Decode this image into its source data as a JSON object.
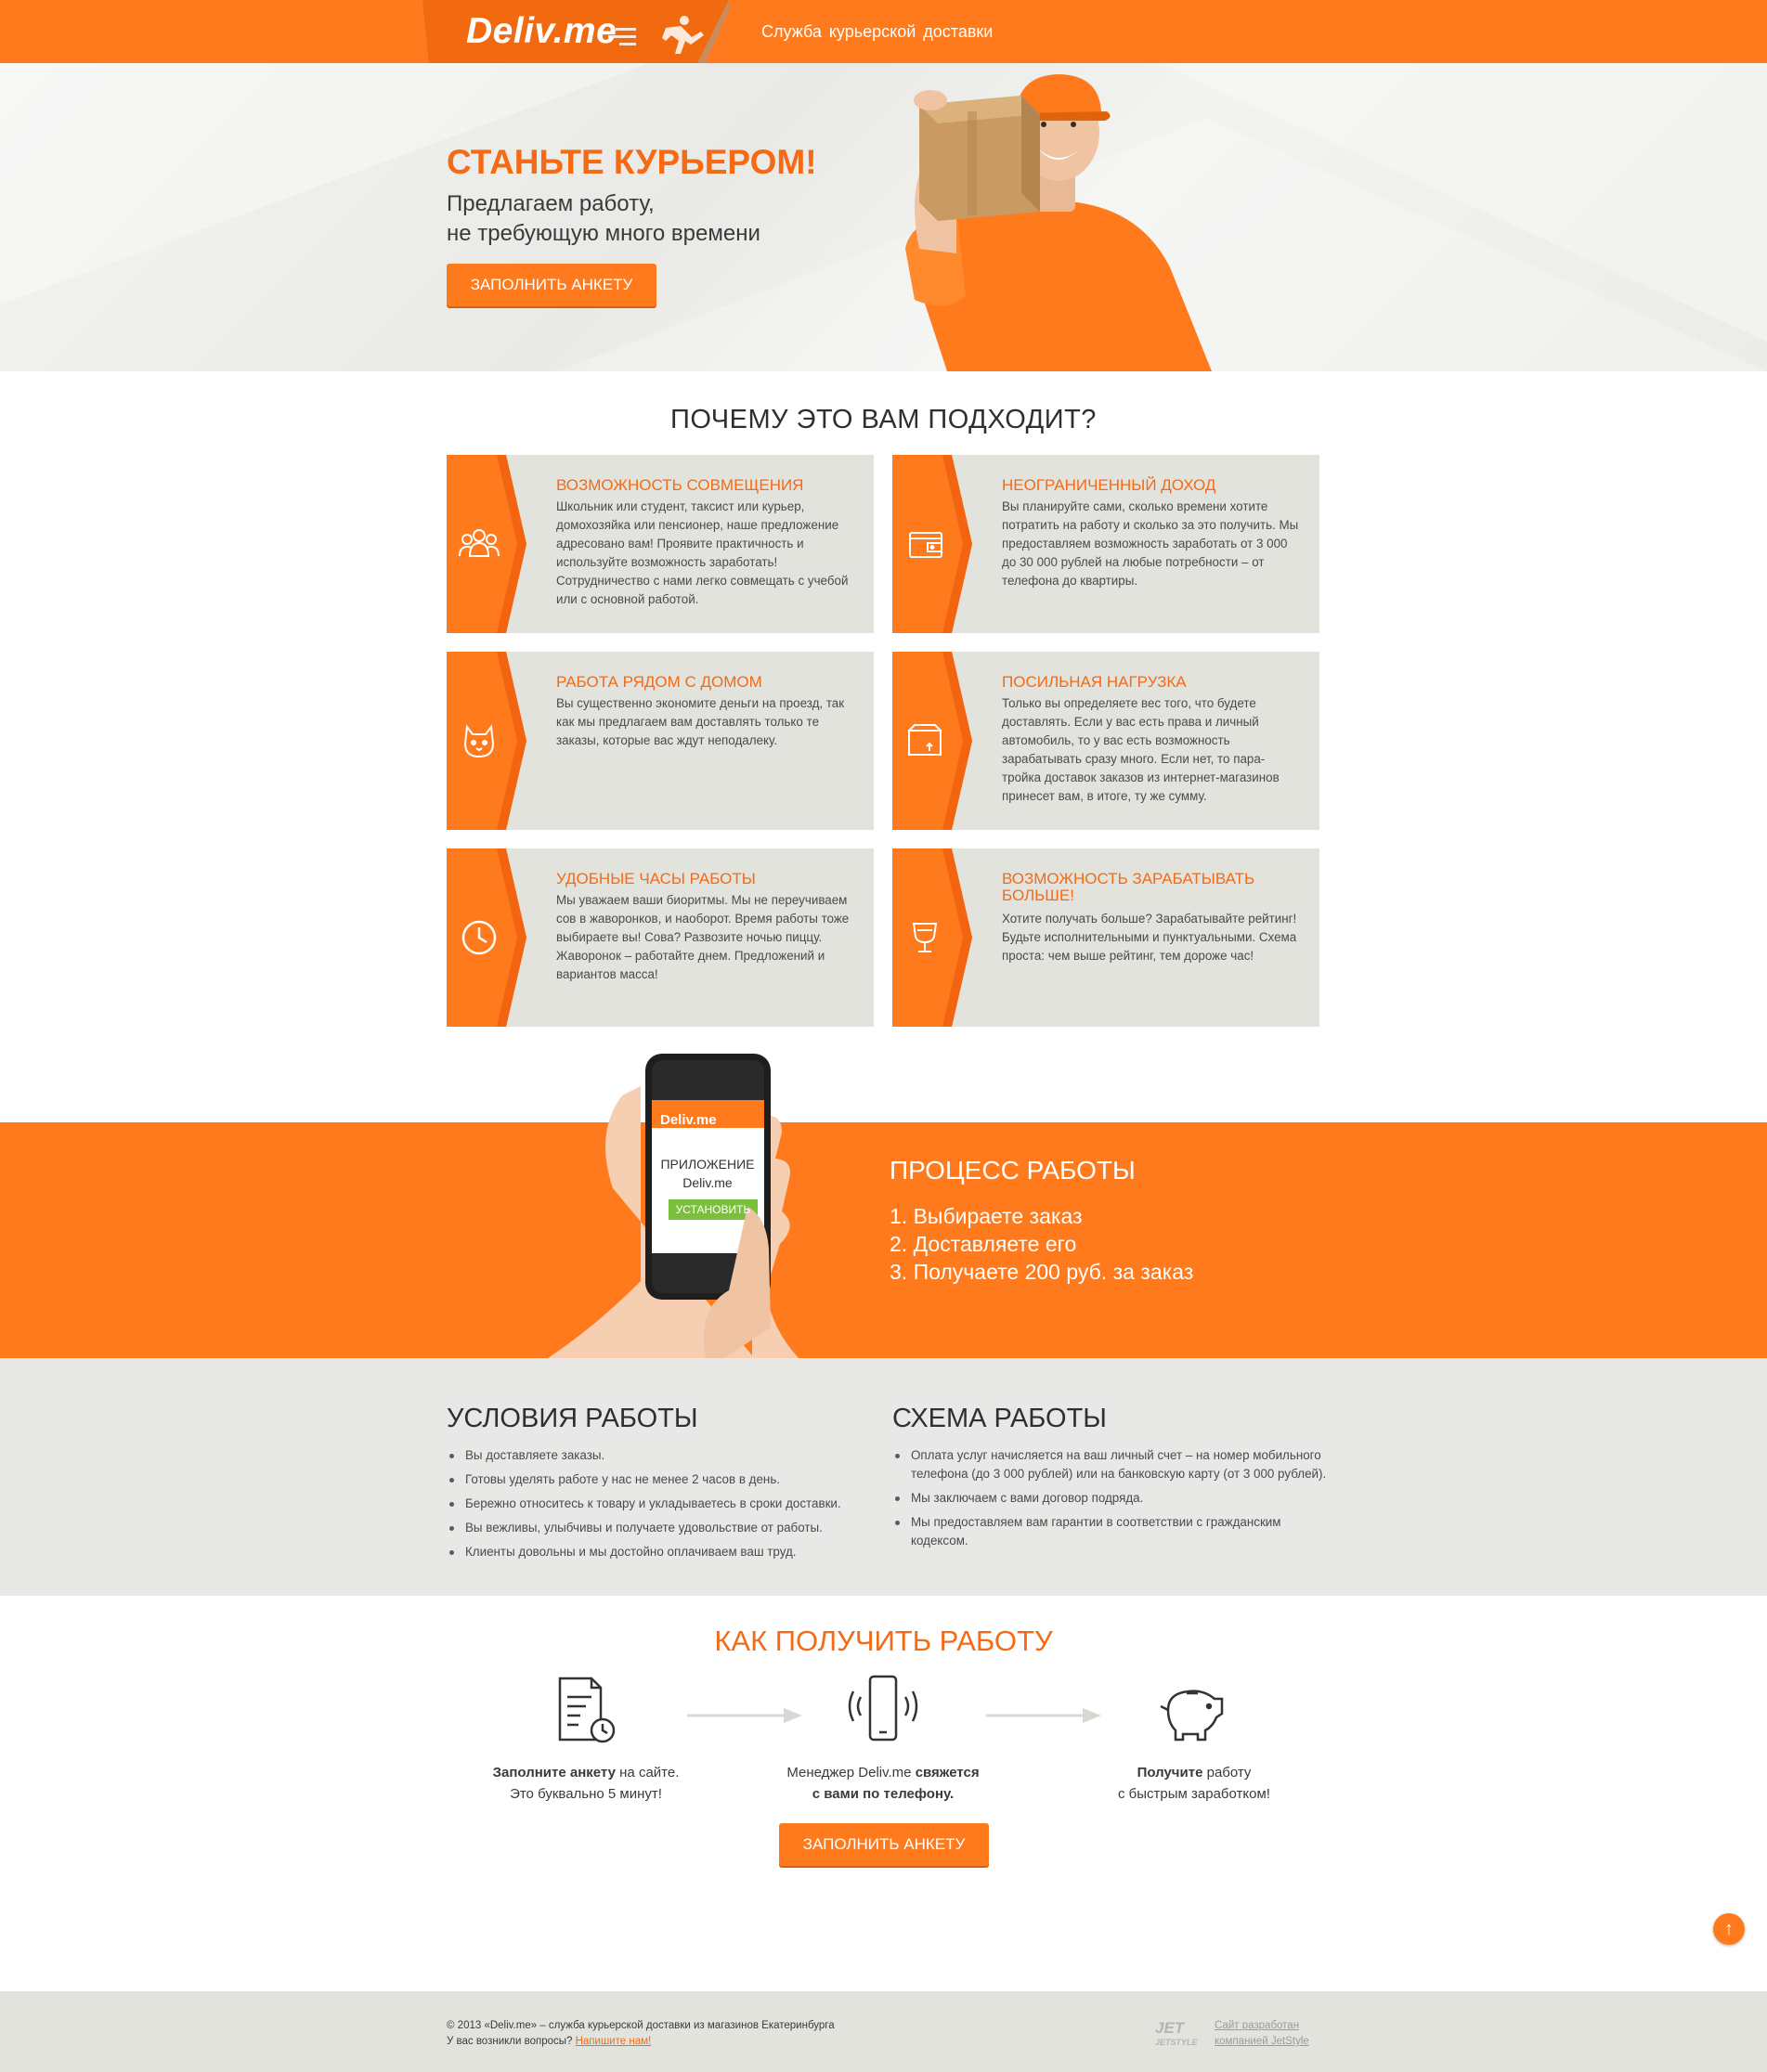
{
  "header": {
    "logo": "Deliv.me",
    "tagline": "Служба курьерской доставки"
  },
  "hero": {
    "title": "СТАНЬТЕ КУРЬЕРОМ!",
    "subtitle_line1": "Предлагаем работу,",
    "subtitle_line2": "не требующую много времени",
    "button": "ЗАПОЛНИТЬ АНКЕТУ"
  },
  "why": {
    "title": "ПОЧЕМУ ЭТО ВАМ ПОДХОДИТ?",
    "cards": [
      {
        "icon": "people-icon",
        "title": "ВОЗМОЖНОСТЬ СОВМЕЩЕНИЯ",
        "text": "Школьник или студент, таксист или курьер, домохозяйка или пенсионер, наше предложение адресовано вам! Проявите практичность и используйте возможность заработать! Сотрудничество с нами легко совмещать с учебой или с основной работой."
      },
      {
        "icon": "wallet-icon",
        "title": "НЕОГРАНИЧЕННЫЙ ДОХОД",
        "text": "Вы планируйте сами, сколько времени хотите потратить на работу и сколько за это получить. Мы предоставляем возможность заработать от 3 000 до 30 000 рублей на любые потребности – от телефона до квартиры."
      },
      {
        "icon": "cat-icon",
        "title": "РАБОТА РЯДОМ С ДОМОМ",
        "text": "Вы существенно экономите деньги на проезд, так как мы предлагаем вам доставлять только те заказы, которые вас ждут неподалеку."
      },
      {
        "icon": "box-icon",
        "title": "ПОСИЛЬНАЯ НАГРУЗКА",
        "text": "Только вы определяете вес того, что будете доставлять. Если у вас есть права и личный автомобиль, то у вас есть возможность зарабатывать сразу много. Если нет, то пара-тройка доставок заказов из интернет-магазинов принесет вам, в итоге, ту же сумму."
      },
      {
        "icon": "clock-icon",
        "title": "УДОБНЫЕ ЧАСЫ РАБОТЫ",
        "text": "Мы уважаем ваши биоритмы. Мы не переучиваем сов в жаворонков, и наоборот. Время работы тоже выбираете вы! Сова? Развозите ночью пиццу. Жаворонок – работайте днем. Предложений и вариантов масса!"
      },
      {
        "icon": "trophy-icon",
        "title": "ВОЗМОЖНОСТЬ ЗАРАБАТЫВАТЬ БОЛЬШЕ!",
        "text": "Хотите получать больше? Зарабатывайте рейтинг! Будьте исполнительными и пунктуальными. Схема проста: чем выше рейтинг, тем дороже час!"
      }
    ]
  },
  "phone": {
    "brand": "Deliv.me",
    "app_line1": "ПРИЛОЖЕНИЕ",
    "app_line2": "Deliv.me",
    "install": "УСТАНОВИТЬ"
  },
  "process": {
    "title": "ПРОЦЕСС РАБОТЫ",
    "steps": [
      "1. Выбираете заказ",
      "2. Доставляете его",
      "3. Получаете 200 руб. за заказ"
    ]
  },
  "conditions": {
    "title": "УСЛОВИЯ РАБОТЫ",
    "items": [
      "Вы доставляете заказы.",
      "Готовы уделять работе у нас не менее 2 часов в день.",
      "Бережно относитесь к товару и укладываетесь в сроки доставки.",
      "Вы вежливы, улыбчивы и получаете удовольствие от работы.",
      "Клиенты довольны и мы достойно оплачиваем ваш труд."
    ]
  },
  "scheme": {
    "title": "СХЕМА РАБОТЫ",
    "items": [
      "Оплата услуг начисляется на ваш личный счет – на номер мобильного телефона (до 3 000 рублей) или на банковскую карту (от 3 000 рублей).",
      "Мы заключаем с вами договор подряда.",
      "Мы предоставляем вам гарантии в соответствии с гражданским кодексом."
    ]
  },
  "how": {
    "title": "КАК ПОЛУЧИТЬ РАБОТУ",
    "step1_bold": "Заполните анкету",
    "step1_rest": " на сайте.",
    "step1_line2": "Это буквально 5 минут!",
    "step2_pre": "Менеджер Deliv.me ",
    "step2_bold": "свяжется",
    "step2_line2": "с вами по телефону.",
    "step3_bold": "Получите",
    "step3_rest": " работу",
    "step3_line2": "с быстрым заработком!",
    "button": "ЗАПОЛНИТЬ АНКЕТУ"
  },
  "footer": {
    "copyright": "© 2013 «Deliv.me» – служба курьерской доставки из магазинов Екатеринбурга",
    "question": "У вас возникли вопросы? ",
    "contact_link": "Напишите нам!",
    "dev_line1": "Сайт разработан",
    "dev_line2": "компанией JetStyle",
    "dev_logo": "JETSTYLE"
  },
  "colors": {
    "accent": "#ff7a1c",
    "accent_text": "#f56a14",
    "card_bg": "#e3e3dd",
    "section_gray": "#e8e8e6"
  }
}
